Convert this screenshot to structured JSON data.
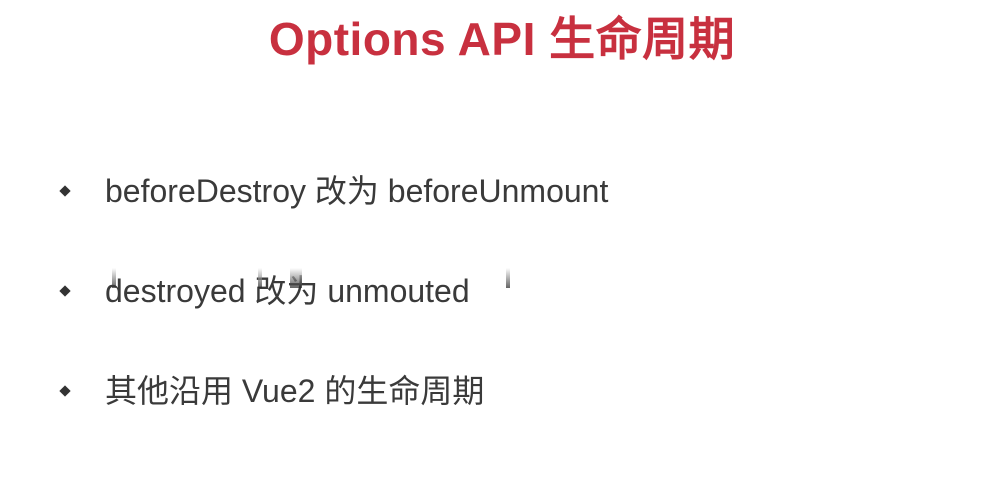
{
  "slide": {
    "title": "Options API 生命周期",
    "bullets": [
      {
        "text": "beforeDestroy 改为 beforeUnmount"
      },
      {
        "text": "destroyed 改为 unmouted"
      },
      {
        "text": "其他沿用 Vue2 的生命周期"
      }
    ]
  },
  "colors": {
    "title": "#c8303f",
    "text": "#3a3a3a",
    "bullet": "#333333",
    "background": "#ffffff"
  },
  "icons": {
    "bullet": "diamond-bullet-icon"
  }
}
